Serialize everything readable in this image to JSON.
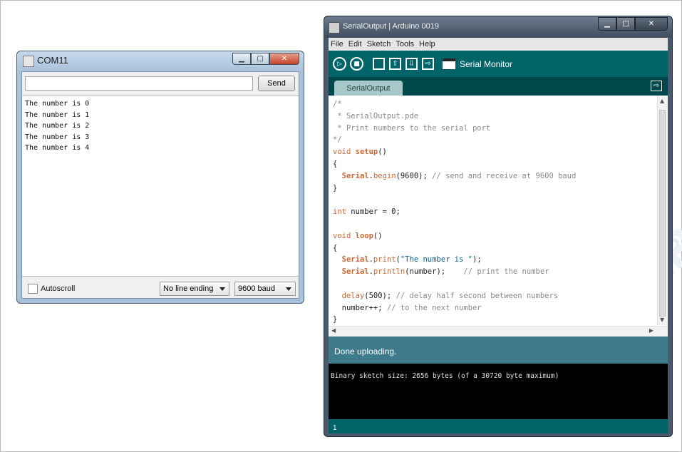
{
  "serial_monitor": {
    "title": "COM11",
    "send_label": "Send",
    "input_value": "",
    "output_lines": [
      "The number is 0",
      "The number is 1",
      "The number is 2",
      "The number is 3",
      "The number is 4"
    ],
    "autoscroll_label": "Autoscroll",
    "line_ending": "No line ending",
    "baud": "9600 baud"
  },
  "ide": {
    "title": "SerialOutput | Arduino 0019",
    "menu": [
      "File",
      "Edit",
      "Sketch",
      "Tools",
      "Help"
    ],
    "toolbar": {
      "serial_monitor_label": "Serial Monitor"
    },
    "tab_label": "SerialOutput",
    "code": {
      "l1": "/*",
      "l2": " * SerialOutput.pde",
      "l3": " * Print numbers to the serial port",
      "l4": "*/",
      "l5_kw": "void",
      "l5_fn": "setup",
      "l5_rest": "()",
      "l6": "{",
      "l7_obj": "Serial",
      "l7_fn": "begin",
      "l7_rest": "(9600); ",
      "l7_cm": "// send and receive at 9600 baud",
      "l8": "}",
      "l10_kw": "int",
      "l10_rest": " number = 0;",
      "l12_kw": "void",
      "l12_fn": "loop",
      "l12_rest": "()",
      "l13": "{",
      "l14_obj": "Serial",
      "l14_fn": "print",
      "l14_open": "(",
      "l14_str": "\"The number is \"",
      "l14_close": ");",
      "l15_obj": "Serial",
      "l15_fn": "println",
      "l15_rest": "(number);    ",
      "l15_cm": "// print the number",
      "l17_fn": "delay",
      "l17_rest": "(500); ",
      "l17_cm": "// delay half second between numbers",
      "l18_rest": "number++; ",
      "l18_cm": "// to the next number",
      "l19": "}"
    },
    "status": "Done uploading.",
    "console": "Binary sketch size: 2656 bytes (of a 30720 byte maximum)",
    "line_number": "1"
  }
}
